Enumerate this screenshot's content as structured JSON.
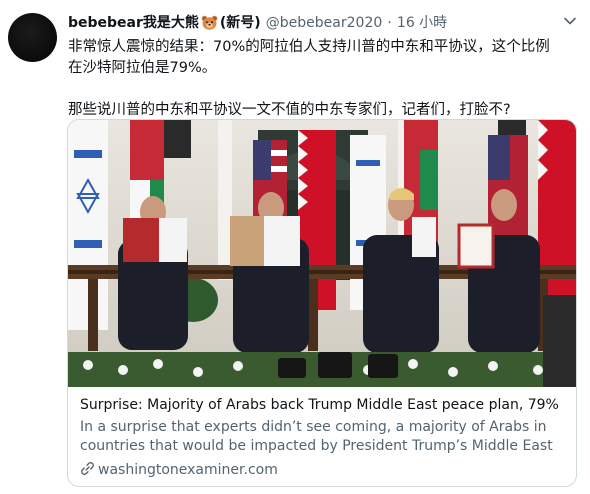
{
  "tweet": {
    "display_name": "bebebear我是大熊",
    "name_suffix": "(新号)",
    "handle": "@bebebear2020",
    "separator": "·",
    "time": "16 小時",
    "paragraph1_line1": "非常惊人震惊的结果：70%的阿拉伯人支持川普的中东和平协议，这个比例",
    "paragraph1_line2": "在沙特阿拉伯是79%。",
    "paragraph2": "那些说川普的中东和平协议一文不值的中东专家们，记者们，打脸不?"
  },
  "card": {
    "title": "Surprise: Majority of Arabs back Trump Middle East peace plan, 79% ...",
    "desc_line1": "In a surprise that experts didn’t see coming, a majority of Arabs in",
    "desc_line2": "countries that would be impacted by President Trump’s Middle East ...",
    "domain": "washingtonexaminer.com"
  },
  "colors": {
    "text_primary": "#0f1419",
    "text_secondary": "#536471",
    "border": "#cfd9de"
  },
  "icons": [
    "bear-emoji-icon",
    "chevron-down-icon",
    "link-icon"
  ]
}
